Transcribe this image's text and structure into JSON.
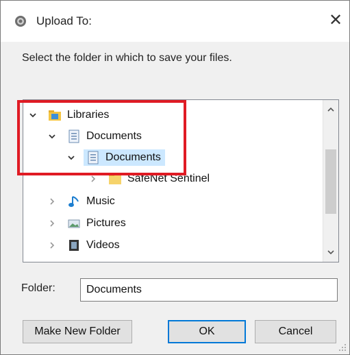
{
  "window": {
    "title": "Upload To:",
    "close_glyph": "✕",
    "title_icon": "upload-icon"
  },
  "instruction": "Select the folder in which to save your files.",
  "tree": {
    "items": [
      {
        "label": "Libraries",
        "icon": "libraries-folder-icon",
        "chevron": "expanded"
      },
      {
        "label": "Documents",
        "icon": "document-library-icon",
        "chevron": "expanded"
      },
      {
        "label": "Documents",
        "icon": "document-library-icon",
        "chevron": "expanded",
        "selected": true
      },
      {
        "label": "SafeNet Sentinel",
        "icon": "folder-icon",
        "chevron": "collapsed"
      },
      {
        "label": "Music",
        "icon": "music-note-icon",
        "chevron": "collapsed"
      },
      {
        "label": "Pictures",
        "icon": "pictures-icon",
        "chevron": "collapsed"
      },
      {
        "label": "Videos",
        "icon": "video-film-icon",
        "chevron": "collapsed"
      }
    ]
  },
  "folder": {
    "label": "Folder:",
    "value": "Documents"
  },
  "buttons": {
    "make_new_folder": "Make New Folder",
    "ok": "OK",
    "cancel": "Cancel"
  },
  "colors": {
    "highlight": "#e01b24",
    "selection": "#cce8ff",
    "default_button_border": "#0078d7"
  }
}
